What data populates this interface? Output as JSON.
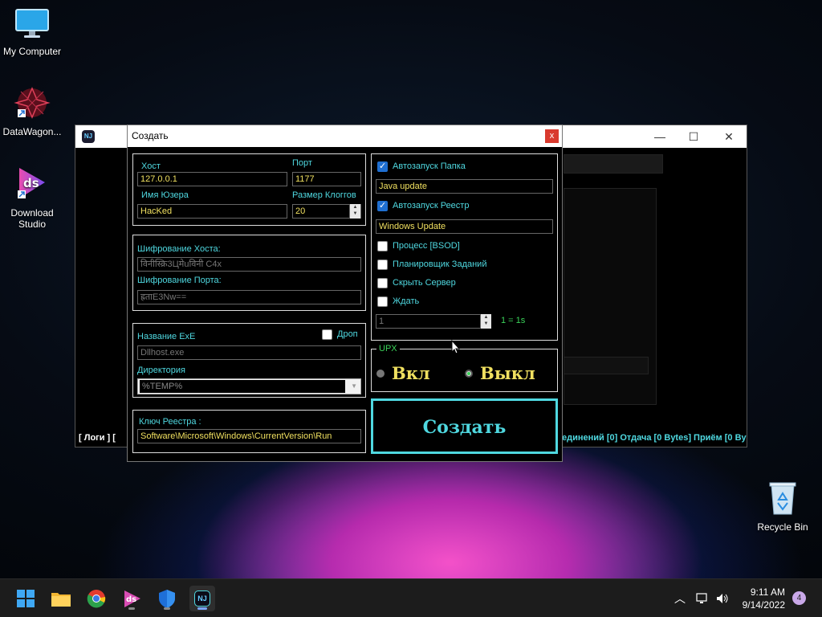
{
  "desktop": {
    "icons": [
      {
        "label": "My Computer"
      },
      {
        "label": "DataWagon..."
      },
      {
        "label_line1": "Download",
        "label_line2": "Studio"
      },
      {
        "label": "Recycle Bin"
      }
    ]
  },
  "background_window": {
    "logo_text": "NJ",
    "status_left": "[ Логи ]   [",
    "status_right": "единений [0]   Отдача [0 Bytes]   Приём [0 By"
  },
  "dialog": {
    "title": "Создать",
    "close_label": "x",
    "host_label": "Хост",
    "host_value": "127.0.0.1",
    "port_label": "Порт",
    "port_value": "1177",
    "user_label": "Имя Юзера",
    "user_value": "HacKed",
    "log_size_label": "Размер Клоггов",
    "log_size_value": "20",
    "host_enc_label": "Шифрование Хоста:",
    "host_enc_value": "विनीस्क्रि3Цमेuविनी C4x",
    "port_enc_label": "Шифрование Порта:",
    "port_enc_value": "ह्रताE3Nw==",
    "exe_label": "Название ExE",
    "drop_label": "Дроп",
    "exe_value": "Dllhost.exe",
    "dir_label": "Директория",
    "dir_value": "%TEMP%",
    "reg_key_label": "Ключ Реестра :",
    "reg_key_value": "Software\\Microsoft\\Windows\\CurrentVersion\\Run",
    "autorun_folder_label": "Автозапуск Папка",
    "autorun_folder_value": "Java update",
    "autorun_reg_label": "Автозапуск Реестр",
    "autorun_reg_value": "Windows Update",
    "process_bsod_label": "Процесс [BSOD]",
    "scheduler_label": "Планировщик Заданий",
    "hide_server_label": "Скрыть Сервер",
    "wait_label": "Ждать",
    "wait_value": "1",
    "wait_hint": "1 = 1s",
    "upx_label": "UPX",
    "upx_on_label": "Вкл",
    "upx_off_label": "Выкл",
    "create_button": "Создать"
  },
  "taskbar": {
    "time": "9:11 AM",
    "date": "9/14/2022",
    "notification_count": "4",
    "active_app_text": "NJ"
  },
  "colors": {
    "accent_cyan": "#4fd8e0",
    "value_yellow": "#f0e060",
    "checkbox_blue": "#1f6fd1",
    "close_red": "#d93a2e"
  }
}
